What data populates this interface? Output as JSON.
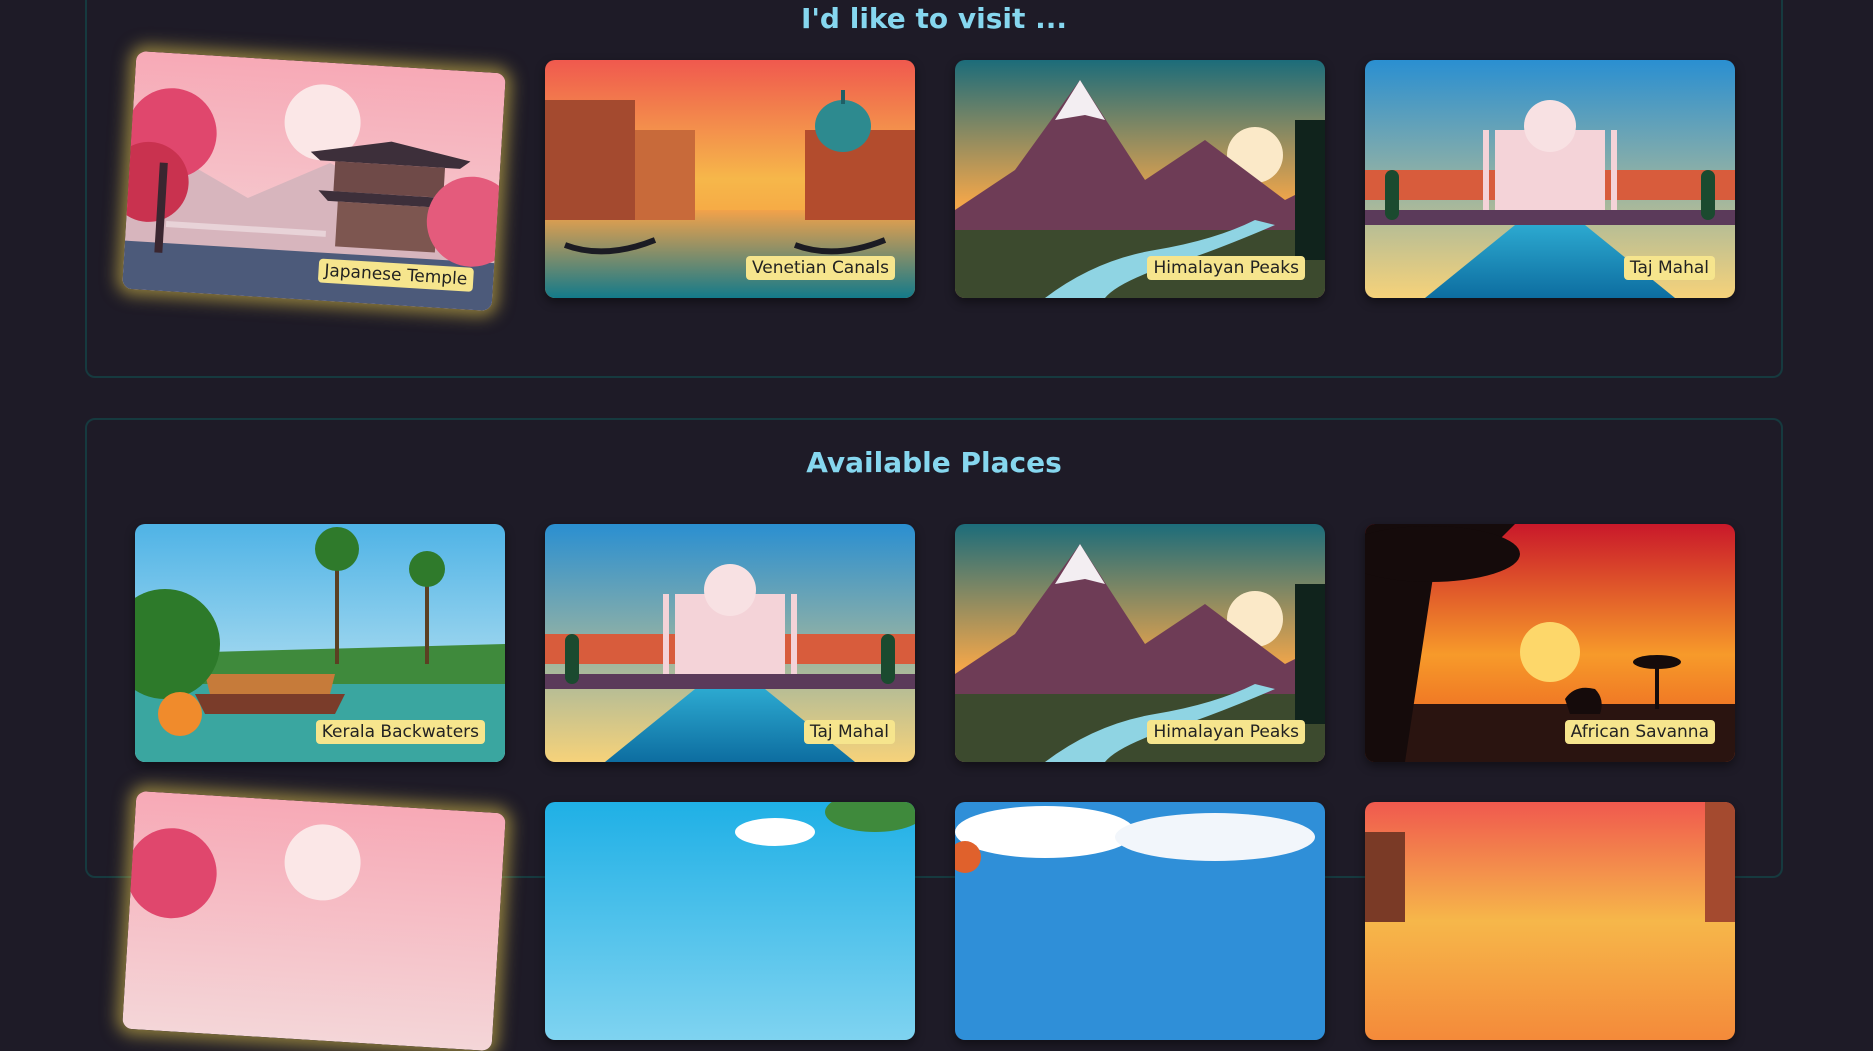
{
  "wishlist": {
    "title": "I'd like to visit ...",
    "places": [
      {
        "title": "Japanese Temple",
        "image": "japanese-temple-image",
        "selected": true
      },
      {
        "title": "Venetian Canals",
        "image": "venetian-canals-image",
        "selected": false
      },
      {
        "title": "Himalayan Peaks",
        "image": "himalayan-peaks-image",
        "selected": false
      },
      {
        "title": "Taj Mahal",
        "image": "taj-mahal-image",
        "selected": false
      }
    ]
  },
  "available": {
    "title": "Available Places",
    "places": [
      {
        "title": "Kerala Backwaters",
        "image": "kerala-backwaters-image",
        "selected": false
      },
      {
        "title": "Taj Mahal",
        "image": "taj-mahal-image",
        "selected": false
      },
      {
        "title": "Himalayan Peaks",
        "image": "himalayan-peaks-image",
        "selected": false
      },
      {
        "title": "African Savanna",
        "image": "african-savanna-image",
        "selected": false
      },
      {
        "title": "",
        "image": "japanese-temple-image",
        "selected": true
      },
      {
        "title": "",
        "image": "beach-image",
        "selected": false
      },
      {
        "title": "",
        "image": "cloudy-sky-image",
        "selected": false
      },
      {
        "title": "",
        "image": "venetian-canals-image",
        "selected": false
      }
    ]
  },
  "colors": {
    "background": "#1e1b27",
    "heading": "#86d7ef",
    "label_background": "#f6e58d",
    "section_border": "#163a3f",
    "selected_glow": "#ecd050"
  }
}
